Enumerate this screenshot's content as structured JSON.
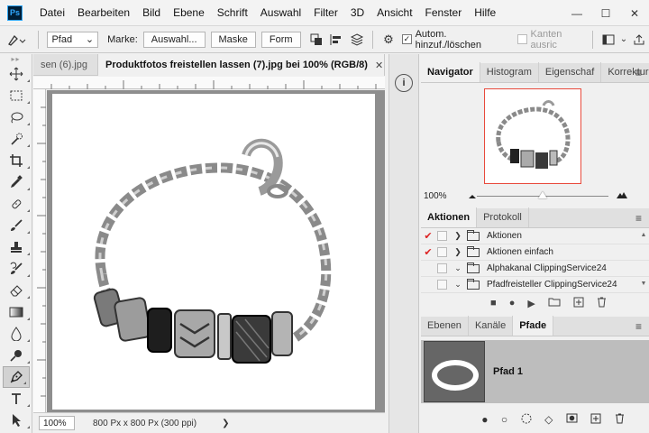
{
  "app": {
    "logo": "Ps"
  },
  "menu": [
    "Datei",
    "Bearbeiten",
    "Bild",
    "Ebene",
    "Schrift",
    "Auswahl",
    "Filter",
    "3D",
    "Ansicht",
    "Fenster",
    "Hilfe"
  ],
  "window_controls": {
    "minimize": "—",
    "maximize": "☐",
    "close": "✕"
  },
  "options": {
    "mode": "Pfad",
    "marke_label": "Marke:",
    "auswahl_button": "Auswahl...",
    "maske_button": "Maske",
    "form_button": "Form",
    "auto_add_label": "Autom. hinzuf./löschen",
    "auto_add_checked": true,
    "align_edges_label": "Kanten ausric",
    "align_edges_enabled": false
  },
  "tabs": [
    {
      "label": "sen (6).jpg",
      "active": false
    },
    {
      "label": "Produktfotos freistellen lassen (7).jpg bei 100% (RGB/8)",
      "active": true
    }
  ],
  "status": {
    "zoom": "100%",
    "doc_info": "800 Px x 800 Px (300 ppi)",
    "arrow": "❯"
  },
  "navigator": {
    "tabs": [
      "Navigator",
      "Histogram",
      "Eigenschaf",
      "Korrekture"
    ],
    "zoom": "100%",
    "zoom_level": 0.5
  },
  "actions_panel": {
    "tabs": [
      "Aktionen",
      "Protokoll"
    ],
    "rows": [
      {
        "checked": true,
        "expanded": false,
        "label": "Aktionen"
      },
      {
        "checked": true,
        "expanded": false,
        "label": "Aktionen einfach"
      },
      {
        "checked": false,
        "expanded": true,
        "label": "Alphakanal ClippingService24"
      },
      {
        "checked": false,
        "expanded": true,
        "label": "Pfadfreisteller ClippingService24"
      }
    ]
  },
  "paths_panel": {
    "tabs": [
      "Ebenen",
      "Kanäle",
      "Pfade"
    ],
    "paths": [
      {
        "name": "Pfad 1"
      }
    ]
  },
  "colors": {
    "accent_red": "#e84a3c",
    "selected_path_row": "#bdbdbd",
    "canvas_bg": "#8e8e8e"
  }
}
